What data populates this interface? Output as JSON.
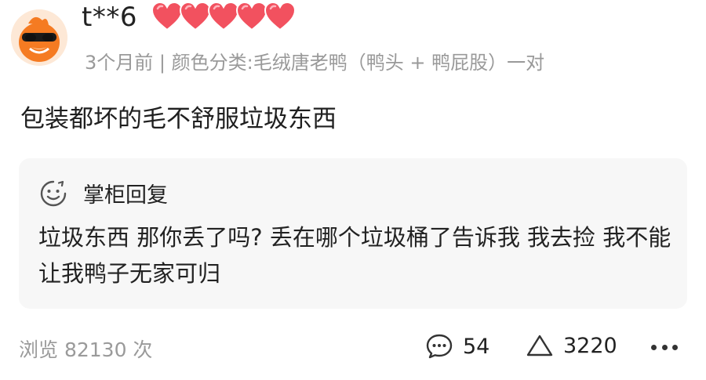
{
  "user": {
    "name": "t**6",
    "hearts": 5,
    "meta": "3个月前 | 颜色分类:毛绒唐老鸭（鸭头 + 鸭屁股）一对"
  },
  "review": {
    "text": "包装都坏的毛不舒服垃圾东西"
  },
  "reply": {
    "title": "掌柜回复",
    "text": "垃圾东西 那你丢了吗? 丢在哪个垃圾桶了告诉我 我去捡 我不能让我鸭子无家可归"
  },
  "footer": {
    "views": "浏览 82130 次",
    "comment_count": "54",
    "like_count": "3220"
  },
  "colors": {
    "heart": "#f2515f",
    "meta_gray": "#999999",
    "reply_bg": "#f7f7f7",
    "avatar_orange": "#f57b22"
  }
}
